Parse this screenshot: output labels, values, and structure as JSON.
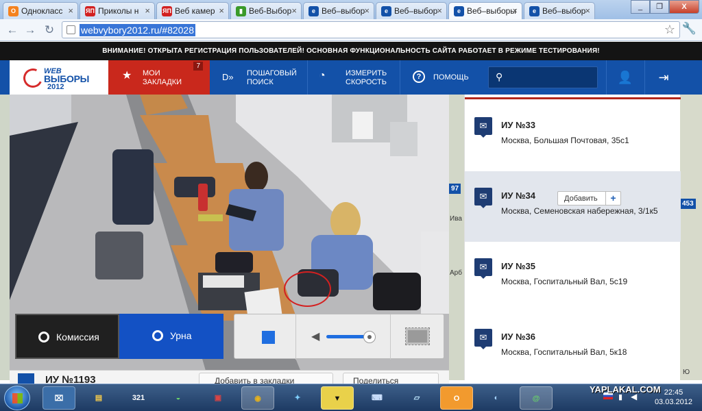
{
  "browser": {
    "tabs": [
      {
        "title": "Однокласс",
        "fav": "ok-icon",
        "color": "#f4821f"
      },
      {
        "title": "Приколы н",
        "fav": "yaplakal-icon",
        "color": "#d22020"
      },
      {
        "title": "Веб камер",
        "fav": "yaplakal-icon",
        "color": "#d22020"
      },
      {
        "title": "Веб-Выбор",
        "fav": "chart-icon",
        "color": "#3a9a2a"
      },
      {
        "title": "Веб–выбор",
        "fav": "webvybory-icon",
        "color": "#1351a8"
      },
      {
        "title": "Веб–выбор",
        "fav": "webvybory-icon",
        "color": "#1351a8"
      },
      {
        "title": "Веб–выборы",
        "fav": "webvybory-icon",
        "color": "#1351a8"
      },
      {
        "title": "Веб–выбор",
        "fav": "webvybory-icon",
        "color": "#1351a8"
      }
    ],
    "url": "webvybory2012.ru/#82028"
  },
  "notice": "ВНИМАНИЕ! ОТКРЫТА РЕГИСТРАЦИЯ ПОЛЬЗОВАТЕЛЕЙ! ОСНОВНАЯ ФУНКЦИОНАЛЬНОСТЬ САЙТА РАБОТАЕТ В РЕЖИМЕ ТЕСТИРОВАНИЯ!",
  "logo": {
    "line1": "WEB",
    "line2": "ВЫБОРЫ",
    "line3": "2012"
  },
  "nav": {
    "bookmarks_l1": "МОИ",
    "bookmarks_l2": "ЗАКЛАДКИ",
    "bookmarks_count": "7",
    "step_l1": "ПОШАГОВЫЙ",
    "step_l2": "ПОИСК",
    "speed_l1": "ИЗМЕРИТЬ",
    "speed_l2": "СКОРОСТЬ",
    "help": "ПОМОЩЬ"
  },
  "video": {
    "camera_commission": "Комиссия",
    "camera_urn": "Урна",
    "volume": 0.85
  },
  "map_labels": [
    "97",
    "Ива",
    "Арб",
    "453",
    "Ю"
  ],
  "bottom": {
    "station_title": "ИУ №1193",
    "add_bookmark": "Добавить в закладки",
    "share": "Поделиться"
  },
  "stations": [
    {
      "title": "ИУ №33",
      "address": "Москва, Большая Почтовая, 35с1"
    },
    {
      "title": "ИУ №34",
      "address": "Москва, Семеновская набережная, 3/1к5",
      "highlight": true,
      "add_label": "Добавить"
    },
    {
      "title": "ИУ №35",
      "address": "Москва, Госпитальный Вал, 5с19"
    },
    {
      "title": "ИУ №36",
      "address": "Москва, Госпитальный Вал, 5к18"
    }
  ],
  "taskbar": {
    "watermark": "YAPLAKAL.COM",
    "time": "22:45",
    "date": "03.03.2012"
  }
}
